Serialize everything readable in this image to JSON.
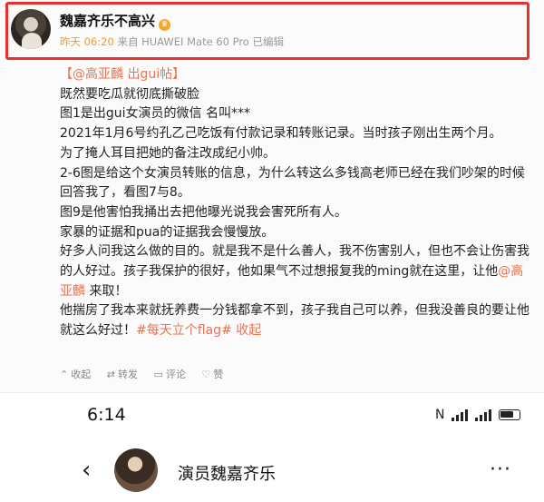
{
  "post": {
    "author": "魏嘉齐乐不高兴",
    "vip_badge": "♛",
    "time": "昨天 06:20",
    "source": "来自 HUAWEI Mate 60 Pro 已编辑",
    "mention_header": "【@高亚麟  出gui帖】",
    "lines": [
      "既然要吃瓜就彻底撕破脸",
      "图1是出gui女演员的微信 名叫***",
      "2021年1月6号约孔乙己吃饭有付款记录和转账记录。当时孩子刚出生两个月。",
      "为了掩人耳目把她的备注改成纪小帅。",
      "2-6图是给这个女演员转账的信息，为什么转这么多钱高老师已经在我们吵架的时候回答我了，看图7与8。",
      "图9是他害怕我捅出去把他曝光说我会害死所有人。",
      "家暴的证据和pua的证据我会慢慢放。"
    ],
    "para_a": "好多人问我这么做的目的。就是我不是什么善人，我不伤害别人，但也不会让伤害我的人好过。孩子我保护的很好，他如果气不过想报复我的ming就在这里，让他",
    "mention_inline": "@高亚麟",
    "para_a_end": " 来取！",
    "para_b": "他揣房了我本来就抚养费一分钱都拿不到，孩子我自己可以养，但我没善良的要让他就这么好过！",
    "hashtag": "#每天立个flag#",
    "collapse": " 收起",
    "actions": {
      "favorite": "收起",
      "repost": "转发",
      "comment": "评论",
      "like": "赞"
    }
  },
  "phone": {
    "clock": "6:14",
    "nfc": "N",
    "profile_name": "演员魏嘉齐乐",
    "back": "‹",
    "more": "···"
  },
  "colors": {
    "highlight_border": "#e8302d",
    "link": "#eb7350",
    "time": "#f29a2e"
  }
}
